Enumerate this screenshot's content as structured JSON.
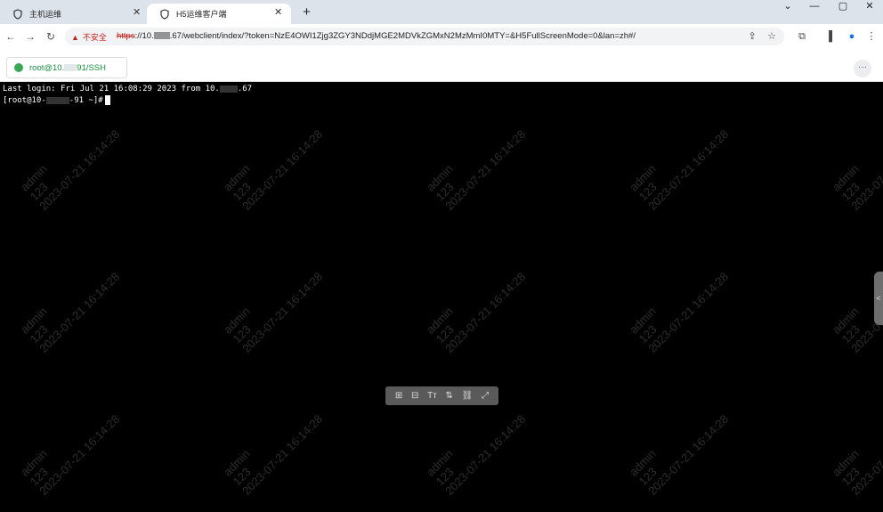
{
  "browser": {
    "tabs": [
      {
        "title": "主机运维",
        "close": "✕"
      },
      {
        "title": "H5运维客户端",
        "close": "✕"
      }
    ],
    "new_tab": "+",
    "window_controls": {
      "minimize": "⌄",
      "min2": "—",
      "maximize": "▢",
      "close": "✕"
    },
    "nav": {
      "back": "←",
      "forward": "→",
      "reload": "↻"
    },
    "security_label": "不安全",
    "url_scheme": "https",
    "url_rest": "://10.",
    "url_path": ".67/webclient/index/?token=NzE4OWI1Zjg3ZGY3NDdjMGE2MDVkZGMxN2MzMmI0MTY=&H5FullScreenMode=0&lan=zh#/",
    "icons": [
      "share-icon",
      "star-icon",
      "extensions-icon",
      "sidepanel-icon",
      "profile-icon",
      "menu-icon"
    ]
  },
  "app": {
    "session_tab": "root@10.",
    "session_tab_suffix": "91/SSH",
    "more": "···"
  },
  "terminal": {
    "line1_prefix": "Last login: Fri Jul 21 16:08:29 2023 from 10.",
    "line1_suffix": ".67",
    "line2_prefix": "[root@10-",
    "line2_suffix": "-91 ~]#"
  },
  "watermark": {
    "user": "admin",
    "id": "123",
    "time": "2023-07-21 16:14:28"
  },
  "float_toolbar": [
    "⊞",
    "⊟",
    "Tт",
    "⇅",
    "⛓",
    "⤢"
  ],
  "side_handle": "<"
}
